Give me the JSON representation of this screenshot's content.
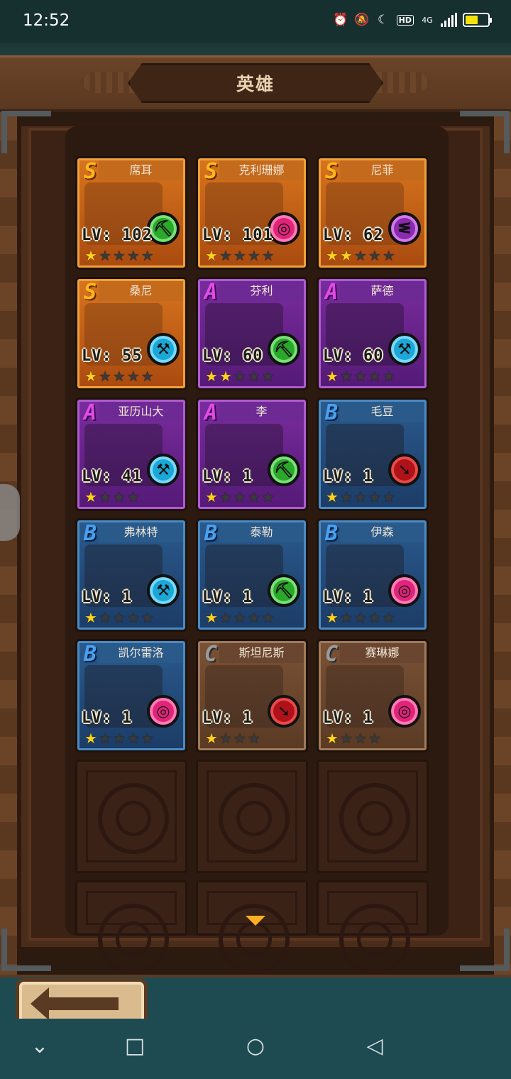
{
  "status_bar": {
    "time": "12:52",
    "icons": [
      "alarm-icon",
      "mute-icon",
      "moon-icon",
      "hd-icon",
      "4g-icon",
      "signal-icon",
      "battery-icon"
    ],
    "hd_label": "HD",
    "network_label": "4G",
    "battery_level": 0.55
  },
  "header": {
    "title": "英雄"
  },
  "colors": {
    "rank_S": "#d8751e",
    "rank_A": "#7a2c9e",
    "rank_B": "#2a5a8e",
    "rank_C": "#7a5236",
    "star_on": "#ffd21c"
  },
  "heroes": [
    {
      "name": "席耳",
      "rank": "S",
      "level_label": "LV: 102",
      "stars_filled": 1,
      "stars_total": 5,
      "class_icon": "pickaxe-icon",
      "class_color": "green"
    },
    {
      "name": "克利珊娜",
      "rank": "S",
      "level_label": "LV: 101",
      "stars_filled": 1,
      "stars_total": 5,
      "class_icon": "orb-icon",
      "class_color": "pink"
    },
    {
      "name": "尼菲",
      "rank": "S",
      "level_label": "LV: 62",
      "stars_filled": 2,
      "stars_total": 5,
      "class_icon": "staff-icon",
      "class_color": "purple"
    },
    {
      "name": "桑尼",
      "rank": "S",
      "level_label": "LV: 55",
      "stars_filled": 1,
      "stars_total": 5,
      "class_icon": "axe-icon",
      "class_color": "cyan"
    },
    {
      "name": "芬利",
      "rank": "A",
      "level_label": "LV: 60",
      "stars_filled": 2,
      "stars_total": 5,
      "class_icon": "pickaxe-icon",
      "class_color": "green"
    },
    {
      "name": "萨德",
      "rank": "A",
      "level_label": "LV: 60",
      "stars_filled": 1,
      "stars_total": 5,
      "class_icon": "axe-icon",
      "class_color": "cyan"
    },
    {
      "name": "亚历山大",
      "rank": "A",
      "level_label": "LV: 41",
      "stars_filled": 1,
      "stars_total": 4,
      "class_icon": "axe-icon",
      "class_color": "cyan"
    },
    {
      "name": "李",
      "rank": "A",
      "level_label": "LV: 1",
      "stars_filled": 1,
      "stars_total": 5,
      "class_icon": "pickaxe-icon",
      "class_color": "green"
    },
    {
      "name": "毛豆",
      "rank": "B",
      "level_label": "LV: 1",
      "stars_filled": 1,
      "stars_total": 5,
      "class_icon": "arrow-icon",
      "class_color": "red"
    },
    {
      "name": "弗林特",
      "rank": "B",
      "level_label": "LV: 1",
      "stars_filled": 1,
      "stars_total": 5,
      "class_icon": "axe-icon",
      "class_color": "cyan"
    },
    {
      "name": "泰勒",
      "rank": "B",
      "level_label": "LV: 1",
      "stars_filled": 1,
      "stars_total": 5,
      "class_icon": "pickaxe-icon",
      "class_color": "green"
    },
    {
      "name": "伊森",
      "rank": "B",
      "level_label": "LV: 1",
      "stars_filled": 1,
      "stars_total": 5,
      "class_icon": "orb-icon",
      "class_color": "pink"
    },
    {
      "name": "凯尔雷洛",
      "rank": "B",
      "level_label": "LV: 1",
      "stars_filled": 1,
      "stars_total": 5,
      "class_icon": "orb-icon",
      "class_color": "pink"
    },
    {
      "name": "斯坦尼斯",
      "rank": "C",
      "level_label": "LV: 1",
      "stars_filled": 1,
      "stars_total": 4,
      "class_icon": "arrow-icon",
      "class_color": "red"
    },
    {
      "name": "赛琳娜",
      "rank": "C",
      "level_label": "LV: 1",
      "stars_filled": 1,
      "stars_total": 4,
      "class_icon": "orb-icon",
      "class_color": "pink"
    }
  ],
  "empty_slots": 6,
  "bottom": {
    "back_button_icon": "back-arrow-icon",
    "scroll_indicator_icon": "chevron-down-icon"
  },
  "nav_bar": {
    "buttons": [
      {
        "name": "nav-collapse-button",
        "icon": "chevron-down-icon",
        "glyph": "⌄"
      },
      {
        "name": "nav-recents-button",
        "icon": "square-icon",
        "glyph": "□"
      },
      {
        "name": "nav-home-button",
        "icon": "circle-icon",
        "glyph": "○"
      },
      {
        "name": "nav-back-button",
        "icon": "triangle-back-icon",
        "glyph": "◁"
      }
    ]
  }
}
